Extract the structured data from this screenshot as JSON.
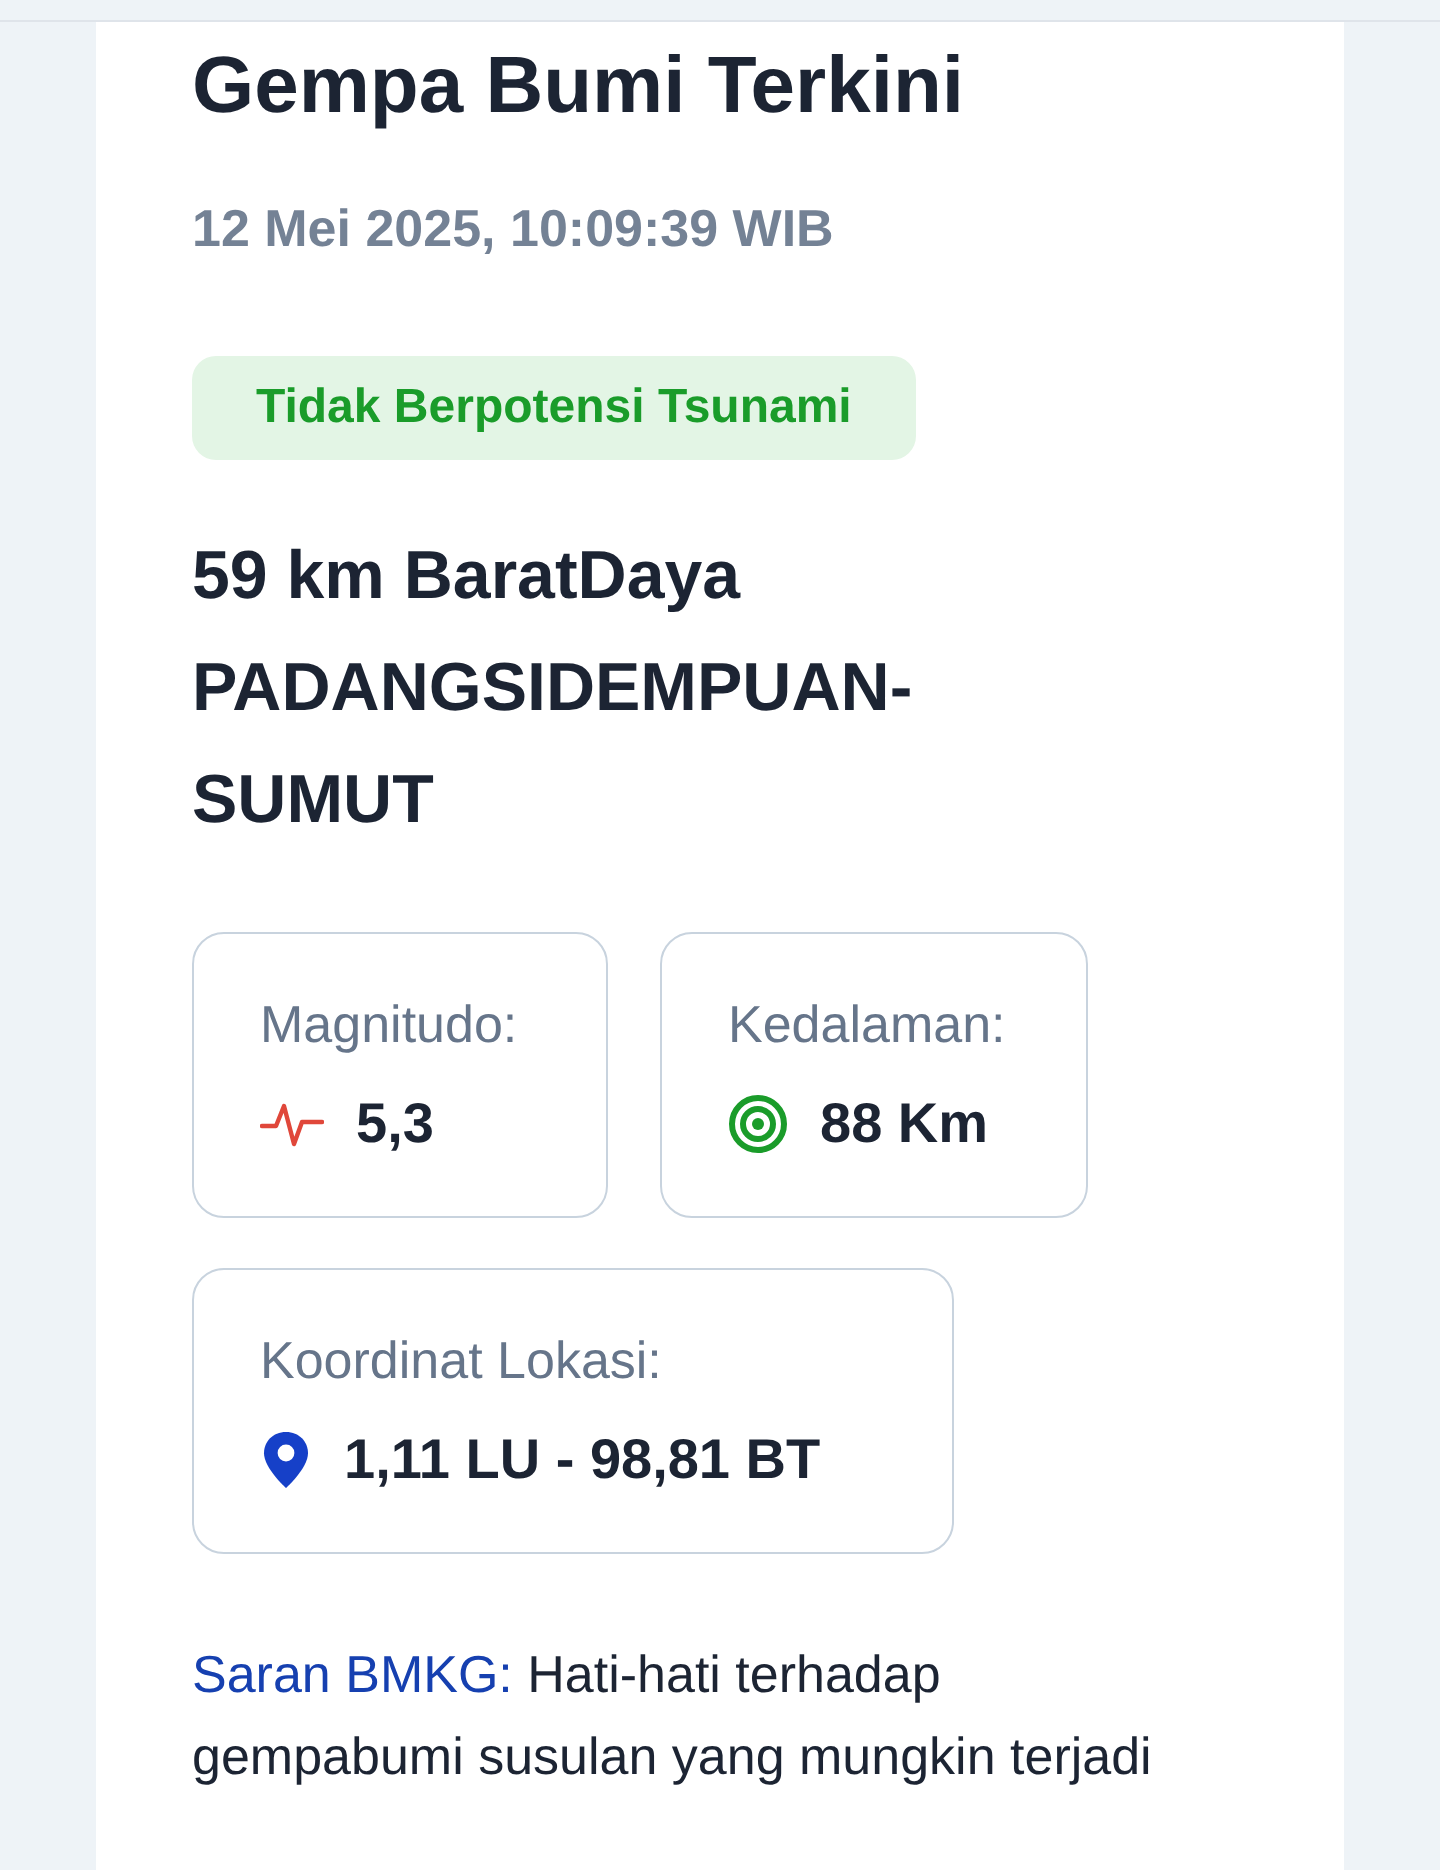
{
  "header": {
    "title": "Gempa Bumi Terkini",
    "datetime": "12 Mei 2025, 10:09:39 WIB"
  },
  "tsunami_badge": {
    "label": "Tidak Berpotensi Tsunami",
    "kind": "safe"
  },
  "location": "59 km BaratDaya PADANGSIDEMPUAN-SUMUT",
  "stats": [
    {
      "kind": "magnitude",
      "label": "Magnitudo:",
      "value": "5,3"
    },
    {
      "kind": "depth",
      "label": "Kedalaman:",
      "value": "88 Km"
    },
    {
      "kind": "coordinates",
      "label": "Koordinat Lokasi:",
      "value": "1,11 LU - 98,81 BT"
    }
  ],
  "advice": {
    "label": "Saran BMKG:",
    "text": "Hati-hati terhadap gempabumi susulan yang mungkin terjadi"
  }
}
